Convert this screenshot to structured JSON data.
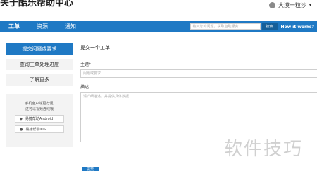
{
  "header": {
    "brand": "关于酷乐帮助中心",
    "user_name": "大漠一粒沙",
    "user_caret": "▾"
  },
  "navbar": {
    "tabs": [
      {
        "label": "工单"
      },
      {
        "label": "资源"
      },
      {
        "label": "通知"
      }
    ],
    "search_placeholder": "输入您的问题，获取自助服务",
    "search_button": "搜索",
    "how_link": "How it works?"
  },
  "sidebar": {
    "items": [
      {
        "label": "提交问题或要求"
      },
      {
        "label": "查询工单处理进度"
      },
      {
        "label": "了解更多"
      }
    ],
    "app_text_1": "手机客户端更方便,",
    "app_text_2": "还可以视频连线哦",
    "app_android": "易捷帮助Android",
    "app_ios": "易捷帮助iOS"
  },
  "form": {
    "title": "提交一个工单",
    "subject_label": "主题*",
    "subject_placeholder": "问题或要求",
    "desc_label": "描述",
    "desc_placeholder": "请详细描述，并提供具体数据",
    "submit": "提交"
  },
  "watermark": "软件技巧",
  "colors": {
    "accent": "#1f79c4",
    "sidebar_bg": "#f3f3f3"
  }
}
